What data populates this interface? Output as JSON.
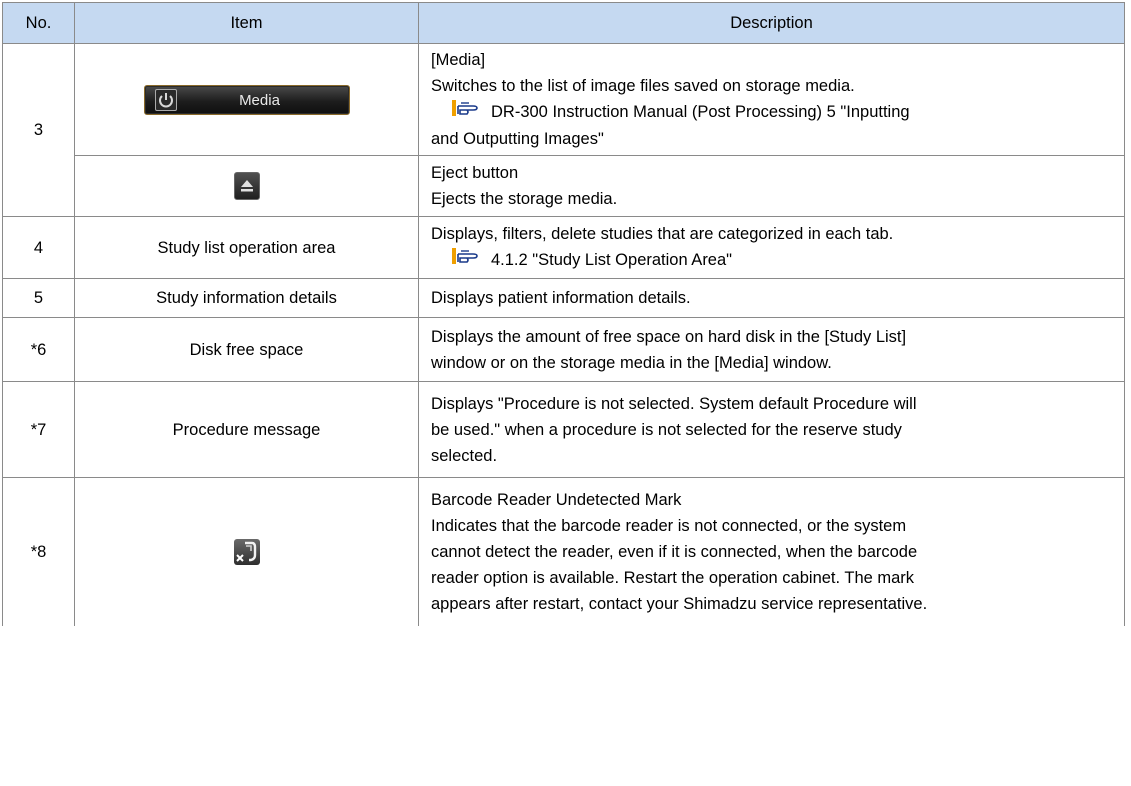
{
  "table": {
    "headers": {
      "no": "No.",
      "item": "Item",
      "description": "Description"
    },
    "rows": [
      {
        "no": "3",
        "image_button_label": "Media",
        "icon": "power-icon",
        "description_lines": [
          "[Media]",
          "Switches to the list of image files saved on storage media."
        ],
        "ref_lines": [
          "DR-300 Instruction Manual (Post Processing) 5   \"Inputting",
          "and Outputting Images\""
        ]
      },
      {
        "icon": "eject-icon",
        "description_lines": [
          "Eject button",
          "Ejects the storage media."
        ]
      },
      {
        "no": "4",
        "item": "Study list operation area",
        "description_lines": [
          "Displays, filters, delete studies that are categorized in each tab."
        ],
        "ref": "4.1.2 \"Study List Operation Area\""
      },
      {
        "no": "5",
        "item": "Study information details",
        "description": "Displays patient information details."
      },
      {
        "no": "*6",
        "item": "Disk free space",
        "description_lines": [
          "Displays the amount of free space on hard disk in the [Study List]",
          "window or on the storage media in the [Media] window."
        ]
      },
      {
        "no": "*7",
        "item": "Procedure message",
        "description_lines": [
          "Displays \"Procedure is not selected. System default Procedure will",
          "be used.\" when a procedure is not selected for the reserve study",
          "selected."
        ]
      },
      {
        "no": "*8",
        "icon": "barcode-reader-undetected-icon",
        "description_lines": [
          "Barcode Reader Undetected Mark",
          "Indicates that the barcode reader is not connected, or the system",
          "cannot detect the reader, even if it is connected, when the barcode",
          "reader option is available. Restart the operation cabinet. The mark",
          "appears after restart, contact your Shimadzu service representative."
        ]
      }
    ]
  },
  "ref_icon": "pointing-hand-reference-icon",
  "colors": {
    "header_bg": "#c5d9f1",
    "border": "#8a8a8a",
    "ref_icon_accent": "#f0a000"
  }
}
